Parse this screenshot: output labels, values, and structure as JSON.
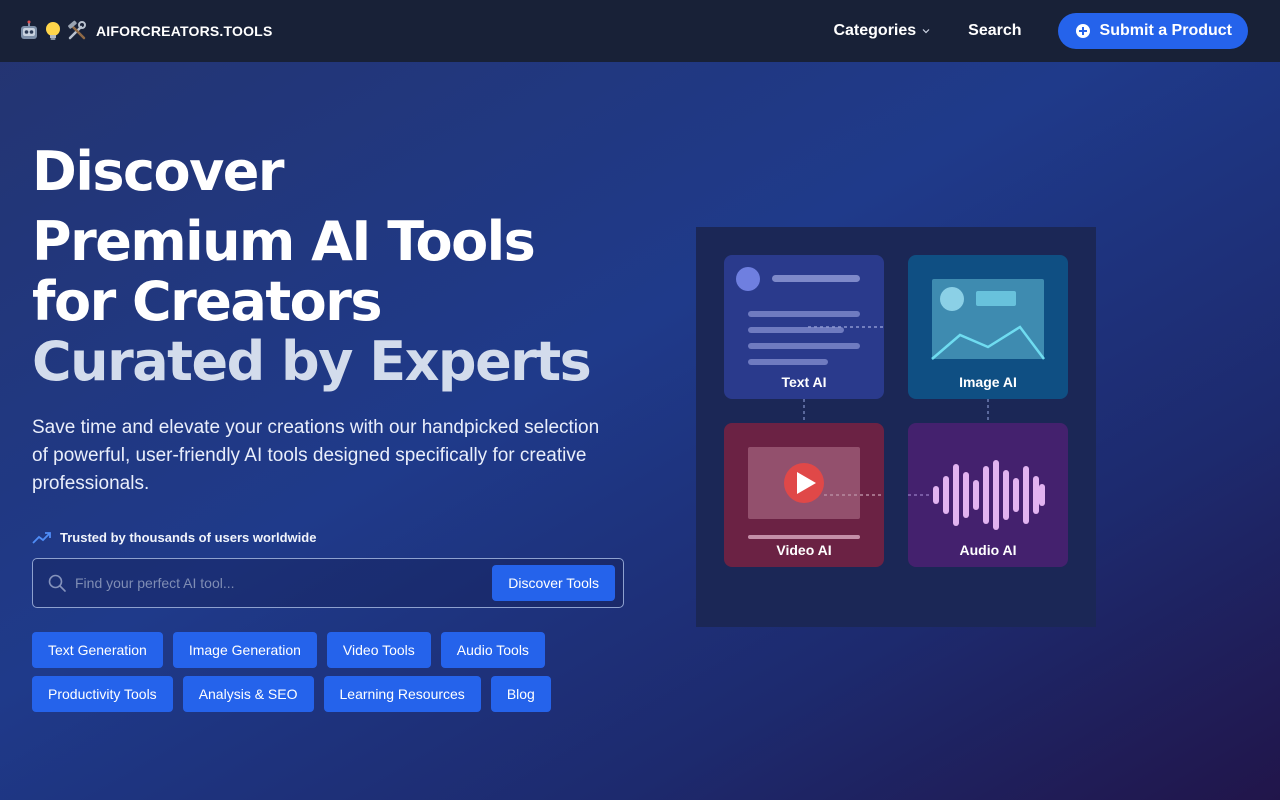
{
  "nav": {
    "brand": "AIFORCREATORS.TOOLS",
    "brand_icons": [
      "robot-icon",
      "lightbulb-icon",
      "tools-icon"
    ],
    "categories": "Categories",
    "search": "Search",
    "submit": "Submit a Product"
  },
  "hero": {
    "line1": "Discover",
    "line2": "Premium AI Tools",
    "line3": "for Creators",
    "line4": "Curated by Experts",
    "subtitle": "Save time and elevate your creations with our handpicked selection of powerful, user-friendly AI tools designed specifically for creative professionals.",
    "trusted": "Trusted by thousands of users worldwide"
  },
  "search": {
    "placeholder": "Find your perfect AI tool...",
    "button": "Discover Tools"
  },
  "chips": [
    "Text Generation",
    "Image Generation",
    "Video Tools",
    "Audio Tools",
    "Productivity Tools",
    "Analysis & SEO",
    "Learning Resources",
    "Blog"
  ],
  "illustration": {
    "text": "Text AI",
    "image": "Image AI",
    "video": "Video AI",
    "audio": "Audio AI"
  },
  "colors": {
    "accent": "#2563eb",
    "nav_bg": "#182137",
    "text_card": "#2a3a8c",
    "image_card": "#0f4f83",
    "video_card": "#6b2244",
    "audio_card": "#44216e",
    "play": "#e04848",
    "wave": "#e2b3f0"
  }
}
